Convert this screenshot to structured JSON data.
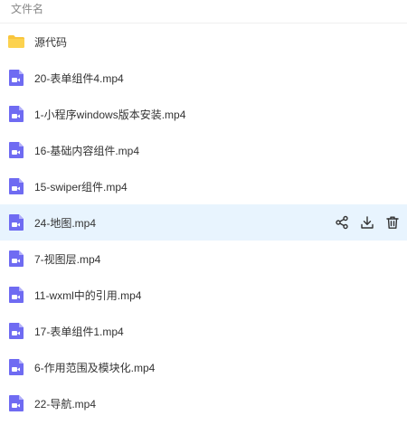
{
  "header": {
    "column_label": "文件名"
  },
  "colors": {
    "folder": "#f9c53c",
    "video_icon": "#6f6bf2",
    "selected_row": "#e8f4fe",
    "action_icon": "#333333"
  },
  "files": [
    {
      "name": "源代码",
      "type": "folder",
      "icon": "folder-icon"
    },
    {
      "name": "20-表单组件4.mp4",
      "type": "video",
      "icon": "video-file-icon"
    },
    {
      "name": "1-小程序windows版本安装.mp4",
      "type": "video",
      "icon": "video-file-icon"
    },
    {
      "name": "16-基础内容组件.mp4",
      "type": "video",
      "icon": "video-file-icon"
    },
    {
      "name": "15-swiper组件.mp4",
      "type": "video",
      "icon": "video-file-icon"
    },
    {
      "name": "24-地图.mp4",
      "type": "video",
      "icon": "video-file-icon",
      "selected": true
    },
    {
      "name": "7-视图层.mp4",
      "type": "video",
      "icon": "video-file-icon"
    },
    {
      "name": "11-wxml中的引用.mp4",
      "type": "video",
      "icon": "video-file-icon"
    },
    {
      "name": "17-表单组件1.mp4",
      "type": "video",
      "icon": "video-file-icon"
    },
    {
      "name": "6-作用范围及模块化.mp4",
      "type": "video",
      "icon": "video-file-icon"
    },
    {
      "name": "22-导航.mp4",
      "type": "video",
      "icon": "video-file-icon"
    }
  ],
  "row_actions": {
    "icons": [
      "share-icon",
      "download-icon",
      "delete-icon"
    ]
  }
}
